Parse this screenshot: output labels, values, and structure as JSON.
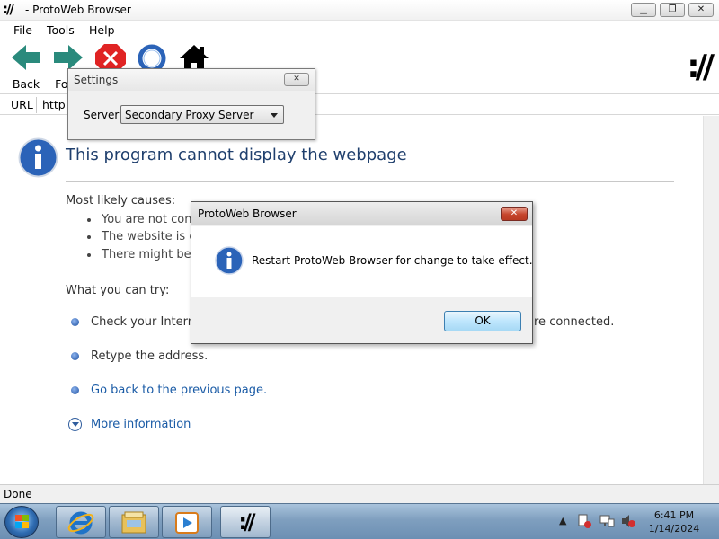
{
  "window": {
    "title": "- ProtoWeb Browser",
    "logo": "://",
    "min_glyph": "▁",
    "max_glyph": "❐",
    "close_glyph": "✕"
  },
  "menu": [
    "File",
    "Tools",
    "Help"
  ],
  "toolbar": {
    "back_label": "Back",
    "forward_label": "Forw",
    "brand_logo": "://"
  },
  "urlbar": {
    "label": "URL",
    "value": "http:/"
  },
  "error_page": {
    "title": "This program cannot display the webpage",
    "causes_heading": "Most likely causes:",
    "causes": [
      "You are not con",
      "The website is en",
      "There might be a"
    ],
    "try_heading": "What you can try:",
    "try_items": [
      "Check your Interne",
      "re connected.",
      "Retype the address.",
      "Go back to the previous page."
    ],
    "more_info": "More information"
  },
  "settings_dialog": {
    "title": "Settings",
    "close_glyph": "✕",
    "server_label": "Server",
    "server_value": "Secondary Proxy Server"
  },
  "alert_dialog": {
    "title": "ProtoWeb Browser",
    "close_glyph": "✕",
    "message": "Restart ProtoWeb Browser for change to take effect.",
    "ok_label": "OK"
  },
  "status": {
    "text": "Done"
  },
  "taskbar": {
    "time": "6:41 PM",
    "date": "1/14/2024",
    "app_logo": "://",
    "tray_arrow": "▲"
  },
  "colors": {
    "arrow_green": "#2a8a7c",
    "stop_red": "#e02424",
    "info_blue": "#2b63b8",
    "link_blue": "#1a5ba6",
    "title_blue": "#1f3f6d"
  }
}
